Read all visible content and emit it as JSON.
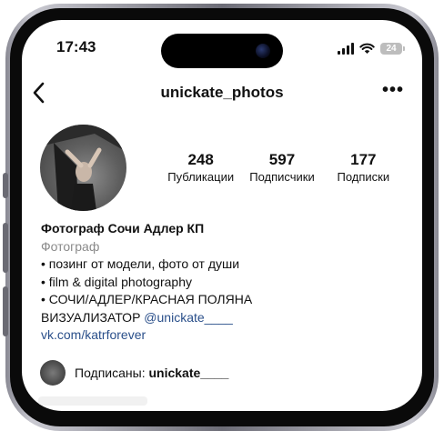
{
  "status_bar": {
    "time": "17:43",
    "battery": "24"
  },
  "nav": {
    "back_symbol": "‹",
    "username": "unickate_photos",
    "more_symbol": "•••"
  },
  "stats": [
    {
      "value": "248",
      "label": "Публикации"
    },
    {
      "value": "597",
      "label": "Подписчики"
    },
    {
      "value": "177",
      "label": "Подписки"
    }
  ],
  "bio": {
    "name": "Фотограф Сочи Адлер КП",
    "category": "Фотограф",
    "lines": [
      "• позинг от модели, фото от души",
      "• film & digital photography",
      "• СОЧИ/АДЛЕР/КРАСНАЯ ПОЛЯНА"
    ],
    "visualizer_text": "ВИЗУАЛИЗАТОР ",
    "visualizer_link": "@unickate____",
    "website": "vk.com/katrforever"
  },
  "followed_by": {
    "prefix": "Подписаны: ",
    "account": "unickate____"
  }
}
